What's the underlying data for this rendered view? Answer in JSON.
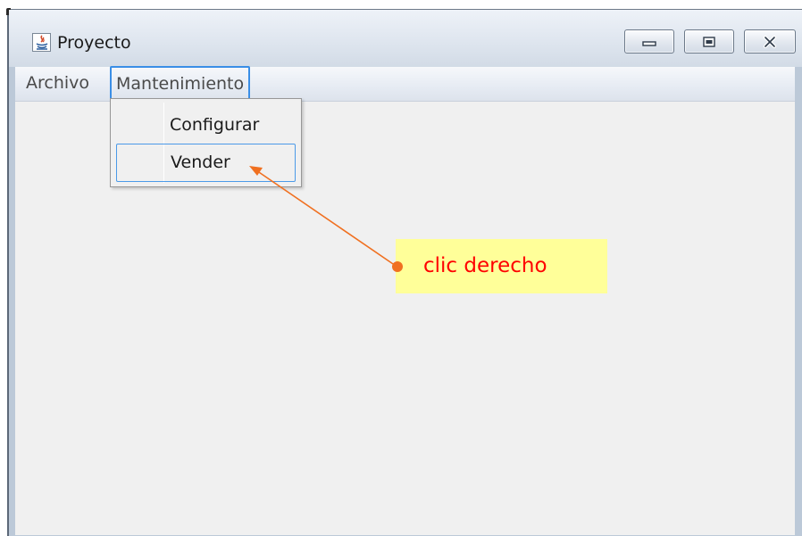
{
  "window": {
    "title": "Proyecto",
    "controls": {
      "minimize": "minimize-icon",
      "maximize": "maximize-icon",
      "close": "close-icon"
    }
  },
  "menubar": {
    "items": [
      {
        "label": "Archivo"
      },
      {
        "label": "Mantenimiento",
        "active": true
      }
    ]
  },
  "popup_menu": {
    "items": [
      {
        "label": "Configurar"
      },
      {
        "label": "Vender",
        "highlighted": true
      }
    ]
  },
  "annotation": {
    "text": "clic derecho",
    "arrow_color": "#f07020",
    "text_color": "#ff0000",
    "background": "#ffff99"
  }
}
